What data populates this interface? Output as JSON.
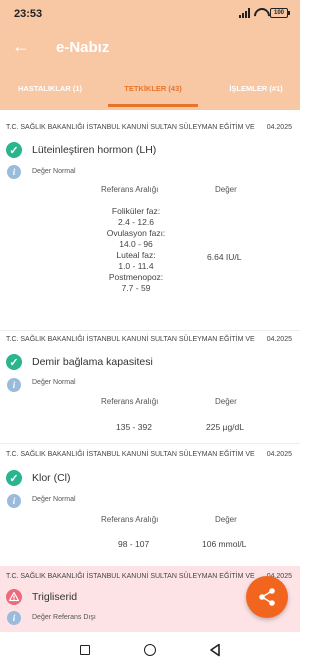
{
  "status_bar": {
    "time": "23:53",
    "battery": "100"
  },
  "app_bar": {
    "back_icon": "arrow-left-icon",
    "title": "e-Nabız"
  },
  "tabs": [
    {
      "label": "HASTALIKLAR (1)",
      "active": false
    },
    {
      "label": "TETKİKLER (43)",
      "active": true
    },
    {
      "label": "İŞLEMLER (#1)",
      "active": false
    }
  ],
  "records": [
    {
      "ministry": "T.C. SAĞLIK BAKANLIĞI İSTANBUL KANUNİ SULTAN SÜLEYMAN EĞİTİM VE",
      "date": "04.2025",
      "test": "Lüteinleştiren hormon (LH)",
      "status": "Değer Normal",
      "ref_label": "Referans Aralığı",
      "value_label": "Değer",
      "ref_lines": [
        "Foliküler faz:",
        "2.4  -  12.6",
        "Ovulasyon fazı:",
        "14.0  -  96",
        "Luteal faz:",
        "1.0  -  11.4",
        "Postmenopoz:",
        "7.7  -  59"
      ],
      "value": "6.64 IU/L"
    },
    {
      "ministry": "T.C. SAĞLIK BAKANLIĞI İSTANBUL KANUNİ SULTAN SÜLEYMAN EĞİTİM VE",
      "date": "04.2025",
      "test": "Demir bağlama kapasitesi",
      "status": "Değer Normal",
      "ref_label": "Referans Aralığı",
      "value_label": "Değer",
      "ref": "135 - 392",
      "value": "225 µg/dL"
    },
    {
      "ministry": "T.C. SAĞLIK BAKANLIĞI İSTANBUL KANUNİ SULTAN SÜLEYMAN EĞİTİM VE",
      "date": "04.2025",
      "test": "Klor (Cl)",
      "status": "Değer Normal",
      "ref_label": "Referans Aralığı",
      "value_label": "Değer",
      "ref": "98 - 107",
      "value": "106 mmol/L"
    },
    {
      "ministry": "T.C. SAĞLIK BAKANLIĞI İSTANBUL KANUNİ SULTAN SÜLEYMAN EĞİTİM VE",
      "date": "04.2025",
      "test": "Trigliserid",
      "status": "Değer Referans Dışı"
    }
  ],
  "fab": {
    "icon": "share-icon"
  },
  "colors": {
    "header": "#f8c7a4",
    "accent": "#e8742a",
    "normal": "#2ab58f",
    "alert_bg": "#fde3e6",
    "fab": "#f2651e"
  }
}
